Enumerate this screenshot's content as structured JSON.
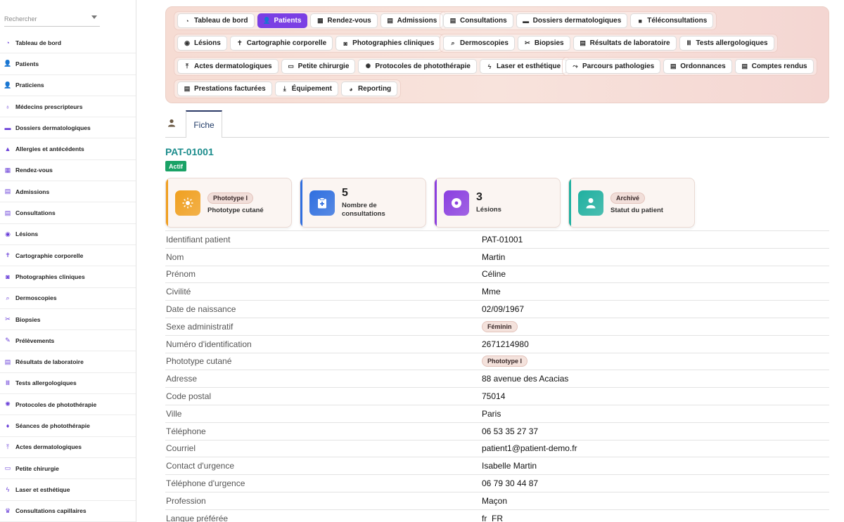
{
  "sidebar": {
    "search_placeholder": "Rechercher",
    "items": [
      {
        "label": "Tableau de bord",
        "icon": "dashboard-icon"
      },
      {
        "label": "Patients",
        "icon": "user-icon"
      },
      {
        "label": "Praticiens",
        "icon": "user-icon"
      },
      {
        "label": "Médecins prescripteurs",
        "icon": "stethoscope-icon"
      },
      {
        "label": "Dossiers dermatologiques",
        "icon": "folder-icon"
      },
      {
        "label": "Allergies et antécédents",
        "icon": "warning-icon"
      },
      {
        "label": "Rendez-vous",
        "icon": "calendar-icon"
      },
      {
        "label": "Admissions",
        "icon": "clipboard-icon"
      },
      {
        "label": "Consultations",
        "icon": "clipboard-icon"
      },
      {
        "label": "Lésions",
        "icon": "disc-icon"
      },
      {
        "label": "Cartographie corporelle",
        "icon": "body-icon"
      },
      {
        "label": "Photographies cliniques",
        "icon": "camera-icon"
      },
      {
        "label": "Dermoscopies",
        "icon": "magnifier-icon"
      },
      {
        "label": "Biopsies",
        "icon": "scissors-icon"
      },
      {
        "label": "Prélèvements",
        "icon": "syringe-icon"
      },
      {
        "label": "Résultats de laboratoire",
        "icon": "document-icon"
      },
      {
        "label": "Tests allergologiques",
        "icon": "vials-icon"
      },
      {
        "label": "Protocoles de photothérapie",
        "icon": "sun-icon"
      },
      {
        "label": "Séances de photothérapie",
        "icon": "bulb-icon"
      },
      {
        "label": "Actes dermatologiques",
        "icon": "procedure-icon"
      },
      {
        "label": "Petite chirurgie",
        "icon": "bed-icon"
      },
      {
        "label": "Laser et esthétique",
        "icon": "bolt-icon"
      },
      {
        "label": "Consultations capillaires",
        "icon": "crown-icon"
      }
    ]
  },
  "nav": {
    "row1a": [
      {
        "label": "Tableau de bord",
        "icon": "dashboard-icon",
        "active": false
      },
      {
        "label": "Patients",
        "icon": "user-icon",
        "active": true
      },
      {
        "label": "Rendez-vous",
        "icon": "calendar-icon",
        "active": false
      },
      {
        "label": "Admissions",
        "icon": "clipboard-icon",
        "active": false
      }
    ],
    "row1b": [
      {
        "label": "Consultations",
        "icon": "clipboard-icon"
      },
      {
        "label": "Dossiers dermatologiques",
        "icon": "folder-icon"
      },
      {
        "label": "Téléconsultations",
        "icon": "video-icon"
      }
    ],
    "row2a": [
      {
        "label": "Lésions",
        "icon": "disc-icon"
      },
      {
        "label": "Cartographie corporelle",
        "icon": "body-icon"
      },
      {
        "label": "Photographies cliniques",
        "icon": "camera-icon"
      }
    ],
    "row2b": [
      {
        "label": "Dermoscopies",
        "icon": "magnifier-icon"
      },
      {
        "label": "Biopsies",
        "icon": "scissors-icon"
      },
      {
        "label": "Résultats de laboratoire",
        "icon": "document-icon"
      },
      {
        "label": "Tests allergologiques",
        "icon": "vials-icon"
      }
    ],
    "row3a": [
      {
        "label": "Actes dermatologiques",
        "icon": "procedure-icon"
      },
      {
        "label": "Petite chirurgie",
        "icon": "bed-icon"
      },
      {
        "label": "Protocoles de photothérapie",
        "icon": "sun-icon"
      },
      {
        "label": "Laser et esthétique",
        "icon": "bolt-icon"
      }
    ],
    "row3b": [
      {
        "label": "Parcours pathologies",
        "icon": "route-icon"
      },
      {
        "label": "Ordonnances",
        "icon": "document-icon"
      },
      {
        "label": "Comptes rendus",
        "icon": "document-icon"
      }
    ],
    "row4": [
      {
        "label": "Prestations facturées",
        "icon": "document-icon"
      },
      {
        "label": "Équipement",
        "icon": "equipment-icon"
      },
      {
        "label": "Reporting",
        "icon": "chart-icon"
      }
    ]
  },
  "tabs": {
    "fiche_label": "Fiche"
  },
  "patient": {
    "id": "PAT-01001",
    "status": "Actif"
  },
  "cards": [
    {
      "badge": "Phototype I",
      "label": "Phototype cutané",
      "color": "#f0a020",
      "icon": "sun-icon"
    },
    {
      "number": "5",
      "label": "Nombre de consultations",
      "color": "#2f6fe0",
      "icon": "clipboard-plus-icon"
    },
    {
      "number": "3",
      "label": "Lésions",
      "color": "#8a3fe0",
      "icon": "disc-icon"
    },
    {
      "badge": "Archivé",
      "label": "Statut du patient",
      "color": "#1fb0a0",
      "icon": "user-icon"
    }
  ],
  "details": [
    {
      "key": "Identifiant patient",
      "value": "PAT-01001"
    },
    {
      "key": "Nom",
      "value": "Martin"
    },
    {
      "key": "Prénom",
      "value": "Céline"
    },
    {
      "key": "Civilité",
      "value": "Mme"
    },
    {
      "key": "Date de naissance",
      "value": "02/09/1967"
    },
    {
      "key": "Sexe administratif",
      "value": "Féminin",
      "pill": true
    },
    {
      "key": "Numéro d'identification",
      "value": "2671214980"
    },
    {
      "key": "Phototype cutané",
      "value": "Phototype I",
      "pill": true
    },
    {
      "key": "Adresse",
      "value": "88 avenue des Acacias"
    },
    {
      "key": "Code postal",
      "value": "75014"
    },
    {
      "key": "Ville",
      "value": "Paris"
    },
    {
      "key": "Téléphone",
      "value": "06 53 35 27 37"
    },
    {
      "key": "Courriel",
      "value": "patient1@patient-demo.fr"
    },
    {
      "key": "Contact d'urgence",
      "value": "Isabelle Martin"
    },
    {
      "key": "Téléphone d'urgence",
      "value": "06 79 30 44 87"
    },
    {
      "key": "Profession",
      "value": "Maçon"
    },
    {
      "key": "Langue préférée",
      "value": "fr_FR"
    }
  ]
}
